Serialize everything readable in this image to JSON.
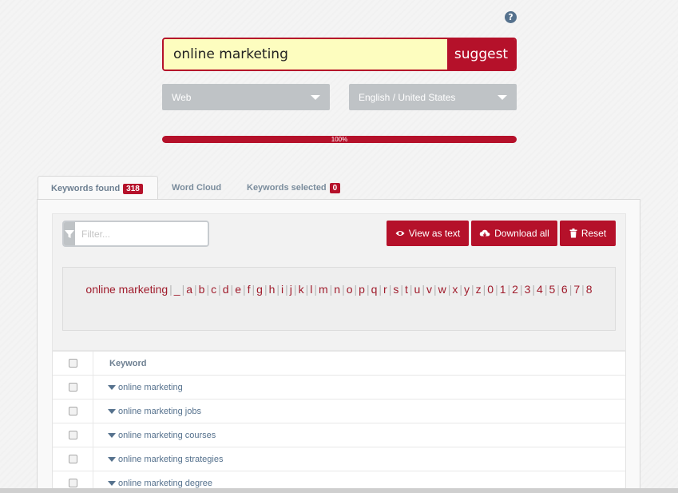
{
  "help_icon": "?",
  "search": {
    "value": "online marketing",
    "button": "suggest"
  },
  "selects": {
    "source": "Web",
    "language": "English / United States"
  },
  "progress": {
    "label": "100%",
    "value": 100
  },
  "tabs": [
    {
      "label": "Keywords found",
      "badge": "318"
    },
    {
      "label": "Word Cloud"
    },
    {
      "label": "Keywords selected",
      "badge": "0"
    }
  ],
  "filter": {
    "placeholder": "Filter..."
  },
  "buttons": {
    "view_text": "View as text",
    "download_all": "Download all",
    "reset": "Reset"
  },
  "alphabet": [
    "online marketing",
    "_",
    "a",
    "b",
    "c",
    "d",
    "e",
    "f",
    "g",
    "h",
    "i",
    "j",
    "k",
    "l",
    "m",
    "n",
    "o",
    "p",
    "q",
    "r",
    "s",
    "t",
    "u",
    "v",
    "w",
    "x",
    "y",
    "z",
    "0",
    "1",
    "2",
    "3",
    "4",
    "5",
    "6",
    "7",
    "8"
  ],
  "table": {
    "header": "Keyword",
    "rows": [
      "online marketing",
      "online marketing jobs",
      "online marketing courses",
      "online marketing strategies",
      "online marketing degree"
    ]
  },
  "colors": {
    "accent": "#b5112a",
    "input_bg": "#fdfdbf",
    "select_bg": "#bfc3c6",
    "link_text": "#55718d"
  }
}
